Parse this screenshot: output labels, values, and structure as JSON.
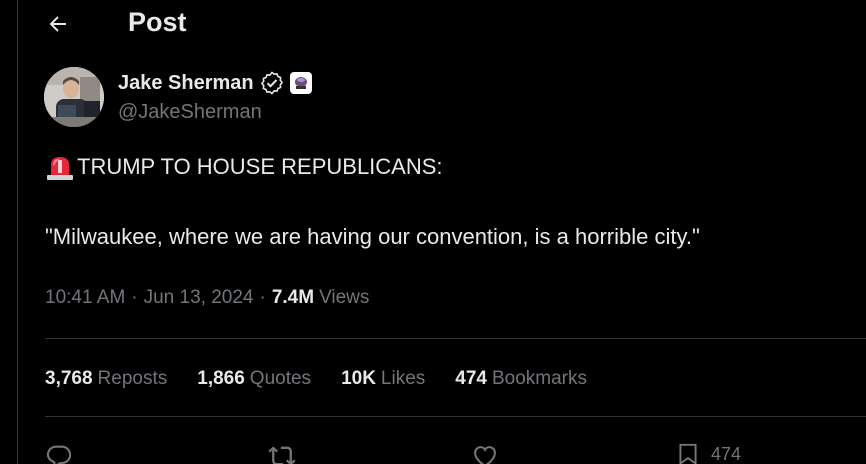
{
  "header": {
    "back_icon": "arrow-left-icon",
    "title": "Post"
  },
  "author": {
    "name": "Jake Sherman",
    "handle": "@JakeSherman",
    "verified_icon": "verified-badge-icon",
    "affiliate_icon": "affiliate-badge-icon"
  },
  "tweet": {
    "emoji_icon": "rotating-light-icon",
    "line1": "TRUMP TO HOUSE REPUBLICANS:",
    "line2": "\"Milwaukee, where we are having our convention, is a horrible city.\""
  },
  "meta": {
    "time": "10:41 AM",
    "separator": "·",
    "date": "Jun 13, 2024",
    "views_count": "7.4M",
    "views_label": "Views"
  },
  "stats": [
    {
      "count": "3,768",
      "label": "Reposts"
    },
    {
      "count": "1,866",
      "label": "Quotes"
    },
    {
      "count": "10K",
      "label": "Likes"
    },
    {
      "count": "474",
      "label": "Bookmarks"
    }
  ],
  "actions": {
    "reply_icon": "reply-icon",
    "repost_icon": "repost-icon",
    "like_icon": "heart-icon",
    "bookmark_icon": "bookmark-icon",
    "bookmark_count": "474"
  },
  "colors": {
    "background": "#000000",
    "text": "#e7e9ea",
    "muted": "#71767b",
    "divider": "#2f3336",
    "verified": "#1d9bf0"
  }
}
